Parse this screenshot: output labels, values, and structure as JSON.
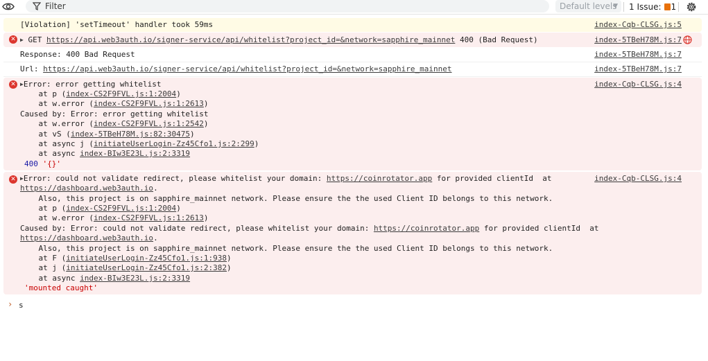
{
  "toolbar": {
    "filter_placeholder": "Filter",
    "levels_label": "Default levels",
    "issues_label": "1 Issue:",
    "issues_count": "1"
  },
  "messages": {
    "violation": {
      "text": "[Violation] 'setTimeout' handler took 59ms",
      "source": "index-Cqb-CLSG.js:5"
    },
    "get": {
      "prefix": "GET",
      "url": "https://api.web3auth.io/signer-service/api/whitelist?project_id=&network=sapphire_mainnet",
      "status": "400 (Bad Request)",
      "source": "index-5TBeH78M.js:7"
    },
    "response": {
      "text": "Response: 400 Bad Request",
      "source": "index-5TBeH78M.js:7"
    },
    "url": {
      "label": "Url:",
      "url": "https://api.web3auth.io/signer-service/api/whitelist?project_id=&network=sapphire_mainnet",
      "source": "index-5TBeH78M.js:7"
    },
    "error1": {
      "source": "index-Cqb-CLSG.js:4",
      "title": "Error: error getting whitelist",
      "at1_pre": "    at p (",
      "at1_link": "index-CS2F9FVL.js:1:2004",
      "at1_post": ")",
      "at2_pre": "    at w.error (",
      "at2_link": "index-CS2F9FVL.js:1:2613",
      "at2_post": ")",
      "caused": "Caused by: Error: error getting whitelist",
      "at3_pre": "    at w.error (",
      "at3_link": "index-CS2F9FVL.js:1:2542",
      "at3_post": ")",
      "at4_pre": "    at vS (",
      "at4_link": "index-5TBeH78M.js:82:30475",
      "at4_post": ")",
      "at5_pre": "    at async j (",
      "at5_link": "initiateUserLogin-Zz45Cfo1.js:2:299",
      "at5_post": ")",
      "at6_pre": "    at async ",
      "at6_link": "index-BIw3E23L.js:2:3319",
      "status_num": "400",
      "status_str": "'{}'"
    },
    "error2": {
      "source": "index-Cqb-CLSG.js:4",
      "title_pre": "Error: could not validate redirect, please whitelist your domain: ",
      "domain": "https://coinrotator.app",
      "title_post": " for provided clientId  at",
      "dashboard": "https://dashboard.web3auth.io",
      "dot": ".",
      "also": "    Also, this project is on sapphire_mainnet network. Please ensure the the used Client ID belongs to this network.",
      "at1_pre": "    at p (",
      "at1_link": "index-CS2F9FVL.js:1:2004",
      "at1_post": ")",
      "at2_pre": "    at w.error (",
      "at2_link": "index-CS2F9FVL.js:1:2613",
      "at2_post": ")",
      "caused_pre": "Caused by: Error: could not validate redirect, please whitelist your domain: ",
      "caused_domain": "https://coinrotator.app",
      "caused_post": " for provided clientId  at",
      "dashboard2": "https://dashboard.web3auth.io",
      "dot2": ".",
      "also2": "    Also, this project is on sapphire_mainnet network. Please ensure the the used Client ID belongs to this network.",
      "at3_pre": "    at F (",
      "at3_link": "initiateUserLogin-Zz45Cfo1.js:1:938",
      "at3_post": ")",
      "at4_pre": "    at j (",
      "at4_link": "initiateUserLogin-Zz45Cfo1.js:2:382",
      "at4_post": ")",
      "at5_pre": "    at async ",
      "at5_link": "index-BIw3E23L.js:2:3319",
      "caught": "'mounted caught'"
    }
  },
  "prompt": {
    "arrow": "›",
    "text": "s"
  },
  "colors": {
    "error_bg": "#fceeee",
    "warning_bg": "#fffbe5",
    "error_icon": "#dc362e",
    "issue_badge": "#e8710a"
  }
}
